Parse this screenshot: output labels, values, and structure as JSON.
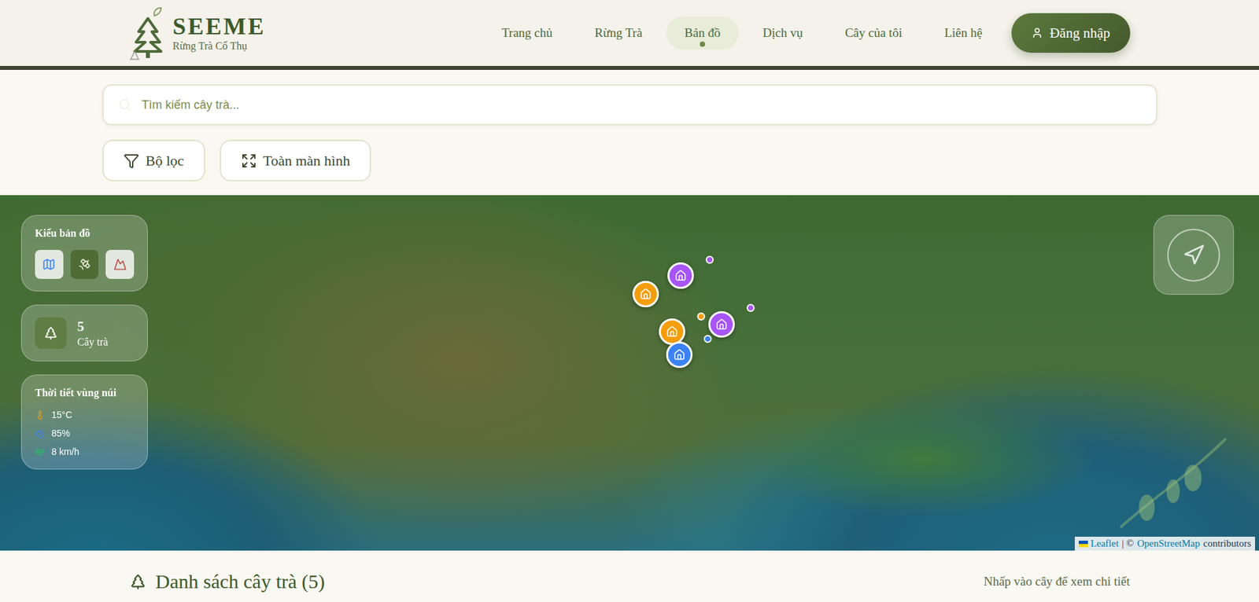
{
  "header": {
    "logo": {
      "title": "SEEME",
      "subtitle": "Rừng Trà Cổ Thụ"
    },
    "nav": [
      {
        "label": "Trang chủ",
        "selected": false
      },
      {
        "label": "Rừng Trà",
        "selected": false
      },
      {
        "label": "Bản đồ",
        "selected": true
      },
      {
        "label": "Dịch vụ",
        "selected": false
      },
      {
        "label": "Cây của tôi",
        "selected": false
      },
      {
        "label": "Liên hệ",
        "selected": false
      }
    ],
    "login": "Đăng nhập"
  },
  "search": {
    "placeholder": "Tìm kiếm cây trà..."
  },
  "toolbar": [
    {
      "label": "Bộ lọc",
      "kind": "filter"
    },
    {
      "label": "Toàn màn hình",
      "kind": "fullscreen"
    }
  ],
  "map": {
    "layers_panel": {
      "title": "Kiểu bản đồ",
      "options": [
        {
          "kind": "street",
          "selected": false
        },
        {
          "kind": "satellite",
          "selected": true
        },
        {
          "kind": "terrain",
          "selected": false
        }
      ]
    },
    "count": {
      "value": "5",
      "label": "Cây trà"
    },
    "weather": {
      "title": "Thời tiết vùng núi",
      "readings": [
        {
          "kind": "temperature",
          "value": "15°C"
        },
        {
          "kind": "humidity",
          "value": "85%"
        },
        {
          "kind": "wind",
          "value": "8 km/h"
        }
      ]
    },
    "markers": [
      {
        "kind": "pin",
        "color": "#f59e0b"
      },
      {
        "kind": "pin",
        "color": "#a855f7"
      },
      {
        "kind": "pin",
        "color": "#f59e0b"
      },
      {
        "kind": "pin",
        "color": "#a855f7"
      },
      {
        "kind": "pin",
        "color": "#3b82f6"
      },
      {
        "kind": "dot",
        "color": "#a855f7"
      },
      {
        "kind": "dot",
        "color": "#f59e0b"
      },
      {
        "kind": "dot",
        "color": "#a855f7"
      },
      {
        "kind": "dot",
        "color": "#3b82f6"
      }
    ],
    "attribution": {
      "leaflet": "Leaflet",
      "separator": "| ©",
      "osm": "OpenStreetMap",
      "suffix": "contributors"
    }
  },
  "list": {
    "title": "Danh sách cây trà (5)",
    "hint": "Nhấp vào cây để xem chi tiết"
  }
}
